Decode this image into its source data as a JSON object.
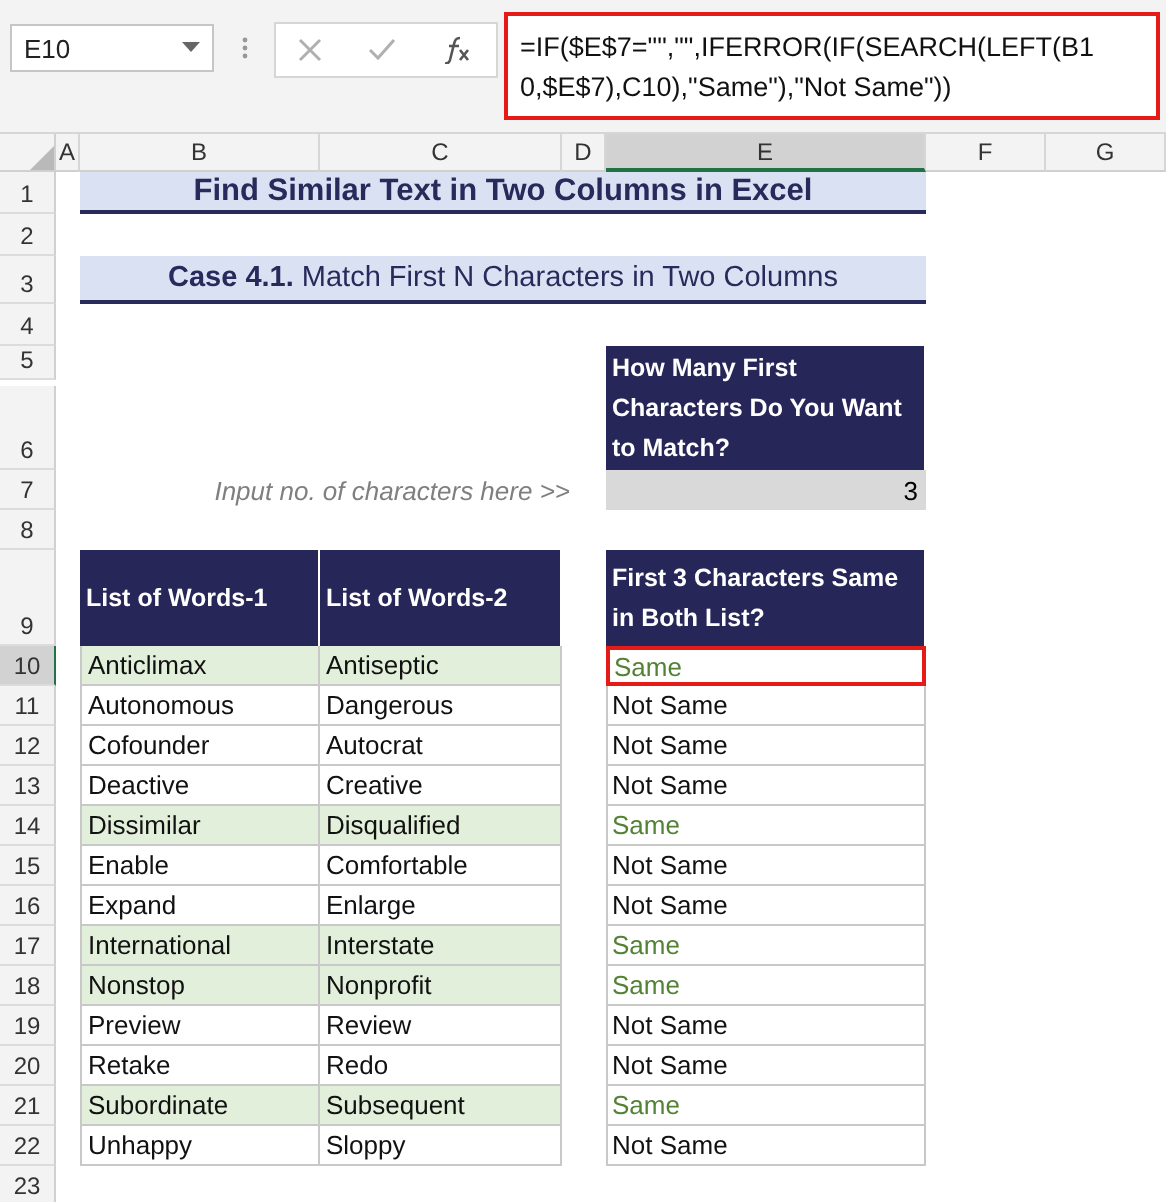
{
  "name_box": "E10",
  "formula": "=IF($E$7=\"\",\"\",IFERROR(IF(SEARCH(LEFT(B10,$E$7),C10),\"Same\"),\"Not Same\"))",
  "columns": [
    {
      "label": "A",
      "selected": false
    },
    {
      "label": "B",
      "selected": false
    },
    {
      "label": "C",
      "selected": false
    },
    {
      "label": "D",
      "selected": false
    },
    {
      "label": "E",
      "selected": true
    },
    {
      "label": "F",
      "selected": false
    },
    {
      "label": "G",
      "selected": false
    }
  ],
  "row_numbers": [
    "1",
    "2",
    "3",
    "4",
    "5",
    "6",
    "7",
    "8",
    "9",
    "10",
    "11",
    "12",
    "13",
    "14",
    "15",
    "16",
    "17",
    "18",
    "19",
    "20",
    "21",
    "22",
    "23"
  ],
  "title": "Find Similar Text in Two Columns in Excel",
  "subtitle": "**Case 4.1.** Match First N Characters in Two Columns",
  "input_heading": "How Many First Characters Do You Want to Match?",
  "input_label": "Input no. of characters here >>",
  "input_value": "3",
  "table": {
    "columns": [
      "List of Words-1",
      "List of Words-2"
    ],
    "result_heading": "First 3 Characters Same in Both List?",
    "rows": [
      {
        "word_1": "Anticlimax",
        "word_2": "Antiseptic",
        "result": "Same",
        "match": true,
        "selected": true
      },
      {
        "word_1": "Autonomous",
        "word_2": "Dangerous",
        "result": "Not Same",
        "match": false,
        "selected": false
      },
      {
        "word_1": "Cofounder",
        "word_2": "Autocrat",
        "result": "Not Same",
        "match": false,
        "selected": false
      },
      {
        "word_1": "Deactive",
        "word_2": "Creative",
        "result": "Not Same",
        "match": false,
        "selected": false
      },
      {
        "word_1": "Dissimilar",
        "word_2": "Disqualified",
        "result": "Same",
        "match": true,
        "selected": false
      },
      {
        "word_1": "Enable",
        "word_2": "Comfortable",
        "result": "Not Same",
        "match": false,
        "selected": false
      },
      {
        "word_1": "Expand",
        "word_2": "Enlarge",
        "result": "Not Same",
        "match": false,
        "selected": false
      },
      {
        "word_1": "International",
        "word_2": "Interstate",
        "result": "Same",
        "match": true,
        "selected": false
      },
      {
        "word_1": "Nonstop",
        "word_2": "Nonprofit",
        "result": "Same",
        "match": true,
        "selected": false
      },
      {
        "word_1": "Preview",
        "word_2": "Review",
        "result": "Not Same",
        "match": false,
        "selected": false
      },
      {
        "word_1": "Retake",
        "word_2": "Redo",
        "result": "Not Same",
        "match": false,
        "selected": false
      },
      {
        "word_1": "Subordinate",
        "word_2": "Subsequent",
        "result": "Same",
        "match": true,
        "selected": false
      },
      {
        "word_1": "Unhappy",
        "word_2": "Sloppy",
        "result": "Not Same",
        "match": false,
        "selected": false
      }
    ]
  }
}
